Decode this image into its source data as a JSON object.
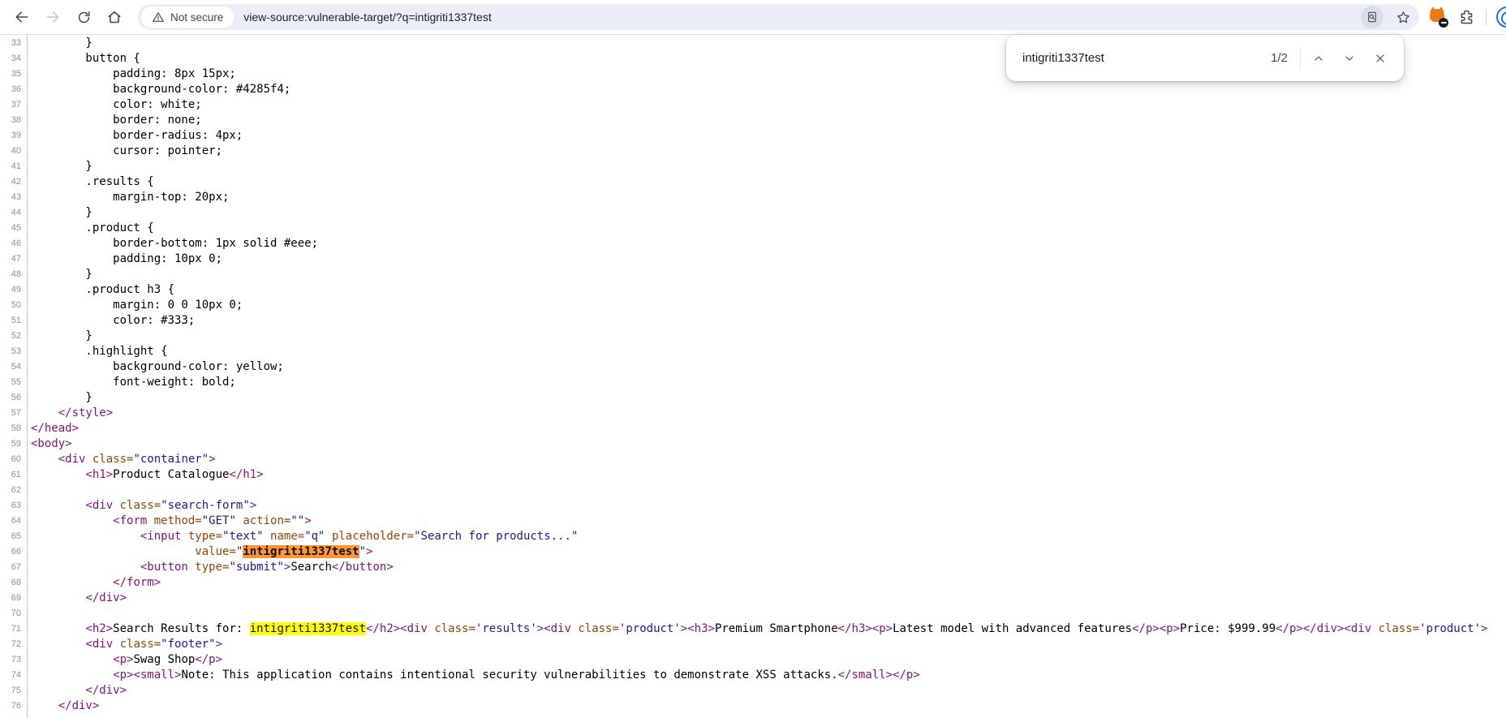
{
  "browser": {
    "url": "view-source:vulnerable-target/?q=intigriti1337test",
    "security_chip": "Not secure",
    "icons": {
      "back": "arrow-left",
      "forward": "arrow-right",
      "reload": "circular-arrow",
      "home": "house",
      "security": "warning-triangle",
      "find_session": "document-magnifier",
      "bookmark": "star-outline",
      "extension_badge": "orange-extension-with-block-badge",
      "extensions": "puzzle-piece",
      "profile": "blue-avatar-ring"
    }
  },
  "find_bar": {
    "query": "intigriti1337test",
    "match_count": "1/2",
    "icons": {
      "previous": "chevron-up",
      "next": "chevron-down",
      "close": "x"
    }
  },
  "colors": {
    "tag": "#881280",
    "attribute": "#994500",
    "value": "#1a1aa6",
    "highlight_active": "#ff9632",
    "highlight_inactive": "#ffff00",
    "omnibox_bg": "#e9eef8",
    "accent_blue": "#1a73e8"
  },
  "source": {
    "lines": [
      {
        "n": 33,
        "tokens": [
          [
            "txt",
            "        }"
          ]
        ]
      },
      {
        "n": 34,
        "tokens": [
          [
            "txt",
            "        button {"
          ]
        ]
      },
      {
        "n": 35,
        "tokens": [
          [
            "txt",
            "            padding: 8px 15px;"
          ]
        ]
      },
      {
        "n": 36,
        "tokens": [
          [
            "txt",
            "            background-color: #4285f4;"
          ]
        ]
      },
      {
        "n": 37,
        "tokens": [
          [
            "txt",
            "            color: white;"
          ]
        ]
      },
      {
        "n": 38,
        "tokens": [
          [
            "txt",
            "            border: none;"
          ]
        ]
      },
      {
        "n": 39,
        "tokens": [
          [
            "txt",
            "            border-radius: 4px;"
          ]
        ]
      },
      {
        "n": 40,
        "tokens": [
          [
            "txt",
            "            cursor: pointer;"
          ]
        ]
      },
      {
        "n": 41,
        "tokens": [
          [
            "txt",
            "        }"
          ]
        ]
      },
      {
        "n": 42,
        "tokens": [
          [
            "txt",
            "        .results {"
          ]
        ]
      },
      {
        "n": 43,
        "tokens": [
          [
            "txt",
            "            margin-top: 20px;"
          ]
        ]
      },
      {
        "n": 44,
        "tokens": [
          [
            "txt",
            "        }"
          ]
        ]
      },
      {
        "n": 45,
        "tokens": [
          [
            "txt",
            "        .product {"
          ]
        ]
      },
      {
        "n": 46,
        "tokens": [
          [
            "txt",
            "            border-bottom: 1px solid #eee;"
          ]
        ]
      },
      {
        "n": 47,
        "tokens": [
          [
            "txt",
            "            padding: 10px 0;"
          ]
        ]
      },
      {
        "n": 48,
        "tokens": [
          [
            "txt",
            "        }"
          ]
        ]
      },
      {
        "n": 49,
        "tokens": [
          [
            "txt",
            "        .product h3 {"
          ]
        ]
      },
      {
        "n": 50,
        "tokens": [
          [
            "txt",
            "            margin: 0 0 10px 0;"
          ]
        ]
      },
      {
        "n": 51,
        "tokens": [
          [
            "txt",
            "            color: #333;"
          ]
        ]
      },
      {
        "n": 52,
        "tokens": [
          [
            "txt",
            "        }"
          ]
        ]
      },
      {
        "n": 53,
        "tokens": [
          [
            "txt",
            "        .highlight {"
          ]
        ]
      },
      {
        "n": 54,
        "tokens": [
          [
            "txt",
            "            background-color: yellow;"
          ]
        ]
      },
      {
        "n": 55,
        "tokens": [
          [
            "txt",
            "            font-weight: bold;"
          ]
        ]
      },
      {
        "n": 56,
        "tokens": [
          [
            "txt",
            "        }"
          ]
        ]
      },
      {
        "n": 57,
        "tokens": [
          [
            "txt",
            "    "
          ],
          [
            "tag",
            "</style>"
          ]
        ]
      },
      {
        "n": 58,
        "tokens": [
          [
            "tag",
            "</head>"
          ]
        ]
      },
      {
        "n": 59,
        "tokens": [
          [
            "tag",
            "<body>"
          ]
        ]
      },
      {
        "n": 60,
        "tokens": [
          [
            "txt",
            "    "
          ],
          [
            "tag",
            "<div "
          ],
          [
            "att",
            "class="
          ],
          [
            "val",
            "\"container\""
          ],
          [
            "tag",
            ">"
          ]
        ]
      },
      {
        "n": 61,
        "tokens": [
          [
            "txt",
            "        "
          ],
          [
            "tag",
            "<h1>"
          ],
          [
            "txt",
            "Product Catalogue"
          ],
          [
            "tag",
            "</h1>"
          ]
        ]
      },
      {
        "n": 62,
        "tokens": []
      },
      {
        "n": 63,
        "tokens": [
          [
            "txt",
            "        "
          ],
          [
            "tag",
            "<div "
          ],
          [
            "att",
            "class="
          ],
          [
            "val",
            "\"search-form\""
          ],
          [
            "tag",
            ">"
          ]
        ]
      },
      {
        "n": 64,
        "tokens": [
          [
            "txt",
            "            "
          ],
          [
            "tag",
            "<form "
          ],
          [
            "att",
            "method="
          ],
          [
            "val",
            "\"GET\""
          ],
          [
            "txt",
            " "
          ],
          [
            "att",
            "action="
          ],
          [
            "val",
            "\"\""
          ],
          [
            "tag",
            ">"
          ]
        ]
      },
      {
        "n": 65,
        "tokens": [
          [
            "txt",
            "                "
          ],
          [
            "tag",
            "<input "
          ],
          [
            "att",
            "type="
          ],
          [
            "val",
            "\"text\""
          ],
          [
            "txt",
            " "
          ],
          [
            "att",
            "name="
          ],
          [
            "val",
            "\"q\""
          ],
          [
            "txt",
            " "
          ],
          [
            "att",
            "placeholder="
          ],
          [
            "val",
            "\"Search for products...\""
          ]
        ]
      },
      {
        "n": 66,
        "tokens": [
          [
            "txt",
            "                        "
          ],
          [
            "att",
            "value="
          ],
          [
            "val",
            "\""
          ],
          [
            "hla",
            "intigriti1337test"
          ],
          [
            "val",
            "\""
          ],
          [
            "tag",
            ">"
          ]
        ]
      },
      {
        "n": 67,
        "tokens": [
          [
            "txt",
            "                "
          ],
          [
            "tag",
            "<button "
          ],
          [
            "att",
            "type="
          ],
          [
            "val",
            "\"submit\""
          ],
          [
            "tag",
            ">"
          ],
          [
            "txt",
            "Search"
          ],
          [
            "tag",
            "</button>"
          ]
        ]
      },
      {
        "n": 68,
        "tokens": [
          [
            "txt",
            "            "
          ],
          [
            "tag",
            "</form>"
          ]
        ]
      },
      {
        "n": 69,
        "tokens": [
          [
            "txt",
            "        "
          ],
          [
            "tag",
            "</div>"
          ]
        ]
      },
      {
        "n": 70,
        "tokens": []
      },
      {
        "n": 71,
        "tokens": [
          [
            "txt",
            "        "
          ],
          [
            "tag",
            "<h2>"
          ],
          [
            "txt",
            "Search Results for: "
          ],
          [
            "hli",
            "intigriti1337test"
          ],
          [
            "tag",
            "</h2><div "
          ],
          [
            "att",
            "class="
          ],
          [
            "val",
            "'results'"
          ],
          [
            "tag",
            "><div "
          ],
          [
            "att",
            "class="
          ],
          [
            "val",
            "'product'"
          ],
          [
            "tag",
            "><h3>"
          ],
          [
            "txt",
            "Premium Smartphone"
          ],
          [
            "tag",
            "</h3><p>"
          ],
          [
            "txt",
            "Latest model with advanced features"
          ],
          [
            "tag",
            "</p><p>"
          ],
          [
            "txt",
            "Price: $999.99"
          ],
          [
            "tag",
            "</p></div><div "
          ],
          [
            "att",
            "class="
          ],
          [
            "val",
            "'product'"
          ],
          [
            "tag",
            ">"
          ]
        ]
      },
      {
        "n": 72,
        "tokens": [
          [
            "txt",
            "        "
          ],
          [
            "tag",
            "<div "
          ],
          [
            "att",
            "class="
          ],
          [
            "val",
            "\"footer\""
          ],
          [
            "tag",
            ">"
          ]
        ]
      },
      {
        "n": 73,
        "tokens": [
          [
            "txt",
            "            "
          ],
          [
            "tag",
            "<p>"
          ],
          [
            "txt",
            "Swag Shop"
          ],
          [
            "tag",
            "</p>"
          ]
        ]
      },
      {
        "n": 74,
        "tokens": [
          [
            "txt",
            "            "
          ],
          [
            "tag",
            "<p><small>"
          ],
          [
            "txt",
            "Note: This application contains intentional security vulnerabilities to demonstrate XSS attacks."
          ],
          [
            "tag",
            "</small></p>"
          ]
        ]
      },
      {
        "n": 75,
        "tokens": [
          [
            "txt",
            "        "
          ],
          [
            "tag",
            "</div>"
          ]
        ]
      },
      {
        "n": 76,
        "tokens": [
          [
            "txt",
            "    "
          ],
          [
            "tag",
            "</div>"
          ]
        ]
      }
    ]
  }
}
